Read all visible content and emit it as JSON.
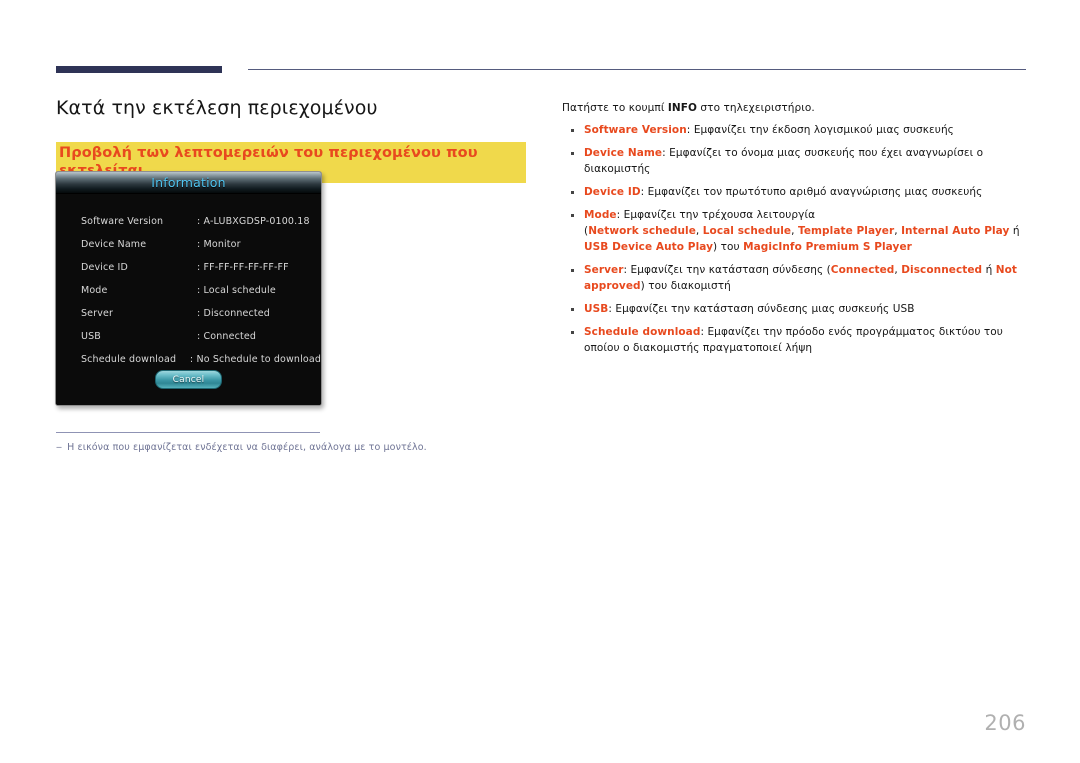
{
  "page": {
    "number": "206",
    "heading": "Κατά την εκτέλεση περιεχομένου",
    "subheading": "Προβολή των λεπτομερειών του περιεχομένου που εκτελείται"
  },
  "dialog": {
    "title": "Information",
    "rows": [
      {
        "label": "Software Version",
        "value": ": A-LUBXGDSP-0100.18"
      },
      {
        "label": "Device Name",
        "value": ": Monitor"
      },
      {
        "label": "Device ID",
        "value": ": FF-FF-FF-FF-FF-FF"
      },
      {
        "label": "Mode",
        "value": ": Local schedule"
      },
      {
        "label": "Server",
        "value": ": Disconnected"
      },
      {
        "label": "USB",
        "value": ": Connected"
      },
      {
        "label": "Schedule download",
        "value": ": No Schedule to download"
      }
    ],
    "cancel_label": "Cancel"
  },
  "footnote": {
    "dash": "‒",
    "text": "Η εικόνα που εμφανίζεται ενδέχεται να διαφέρει, ανάλογα με το μοντέλο."
  },
  "content": {
    "intro_before": "Πατήστε το κουμπί ",
    "intro_key": "INFO",
    "intro_after": " στο τηλεχειριστήριο.",
    "bullets": [
      {
        "term": "Software Version",
        "rest": ": Εμφανίζει την έκδοση λογισμικού μιας συσκευής"
      },
      {
        "term": "Device Name",
        "rest": ": Εμφανίζει το όνομα μιας συσκευής που έχει αναγνωρίσει ο διακομιστής"
      },
      {
        "term": "Device ID",
        "rest": ": Εμφανίζει τον πρωτότυπο αριθμό αναγνώρισης μιας συσκευής"
      },
      {
        "term": "Mode",
        "rest": ": Εμφανίζει την τρέχουσα λειτουργία",
        "seg": [
          {
            "t": "(",
            "hl": false
          },
          {
            "t": "Network schedule",
            "hl": true
          },
          {
            "t": ", ",
            "hl": false
          },
          {
            "t": "Local schedule",
            "hl": true
          },
          {
            "t": ", ",
            "hl": false
          },
          {
            "t": "Template Player",
            "hl": true
          },
          {
            "t": ", ",
            "hl": false
          },
          {
            "t": "Internal Auto Play",
            "hl": true
          },
          {
            "t": " ή ",
            "hl": false
          },
          {
            "t": "USB Device Auto Play",
            "hl": true
          },
          {
            "t": ") του ",
            "hl": false
          },
          {
            "t": "MagicInfo Premium S Player",
            "hl": true
          }
        ]
      },
      {
        "term": "Server",
        "seg": [
          {
            "t": ": Εμφανίζει την κατάσταση σύνδεσης (",
            "hl": false
          },
          {
            "t": "Connected",
            "hl": true
          },
          {
            "t": ", ",
            "hl": false
          },
          {
            "t": "Disconnected",
            "hl": true
          },
          {
            "t": " ή ",
            "hl": false
          },
          {
            "t": "Not approved",
            "hl": true
          },
          {
            "t": ") του διακομιστή",
            "hl": false
          }
        ]
      },
      {
        "term": "USB",
        "rest": ": Εμφανίζει την κατάσταση σύνδεσης μιας συσκευής USB"
      },
      {
        "term": "Schedule download",
        "rest": ": Εμφανίζει την πρόοδο ενός προγράμματος δικτύου του οποίου ο διακομιστής πραγματοποιεί λήψη"
      }
    ]
  },
  "colors": {
    "accent_red": "#e8491e",
    "highlight_yellow": "#f0d94b",
    "rule_navy": "#2e3356",
    "osd_title_blue": "#4fc4f0",
    "footnote_purple": "#6f7495"
  }
}
